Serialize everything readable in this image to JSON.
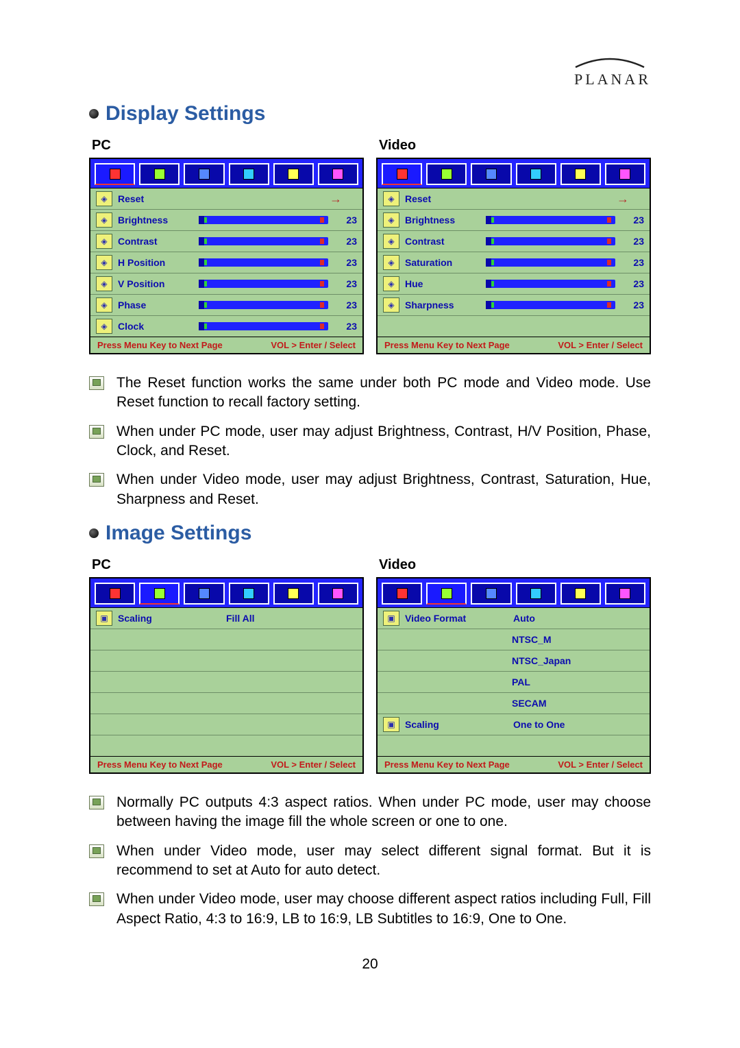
{
  "brand": "PLANAR",
  "page_number": "20",
  "sections": {
    "display": {
      "title": "Display Settings",
      "pc_label": "PC",
      "video_label": "Video",
      "footer_left": "Press Menu Key to Next Page",
      "footer_right": "VOL > Enter / Select",
      "pc_rows": [
        {
          "icon": "reset-icon",
          "label": "Reset",
          "arrow": "→"
        },
        {
          "icon": "brightness-icon",
          "label": "Brightness",
          "value": "23"
        },
        {
          "icon": "contrast-icon",
          "label": "Contrast",
          "value": "23"
        },
        {
          "icon": "hpos-icon",
          "label": "H  Position",
          "value": "23"
        },
        {
          "icon": "vpos-icon",
          "label": "V  Position",
          "value": "23"
        },
        {
          "icon": "phase-icon",
          "label": "Phase",
          "value": "23"
        },
        {
          "icon": "clock-icon",
          "label": "Clock",
          "value": "23"
        }
      ],
      "video_rows": [
        {
          "icon": "reset-icon",
          "label": "Reset",
          "arrow": "→"
        },
        {
          "icon": "brightness-icon",
          "label": "Brightness",
          "value": "23"
        },
        {
          "icon": "contrast-icon",
          "label": "Contrast",
          "value": "23"
        },
        {
          "icon": "saturation-icon",
          "label": "Saturation",
          "value": "23"
        },
        {
          "icon": "hue-icon",
          "label": "Hue",
          "value": "23"
        },
        {
          "icon": "sharpness-icon",
          "label": "Sharpness",
          "value": "23"
        }
      ],
      "notes": [
        "The Reset function works the same under both PC mode and Video mode. Use Reset function to recall factory setting.",
        "When under PC mode, user may adjust Brightness, Contrast, H/V Position, Phase, Clock, and Reset.",
        "When under Video mode, user may adjust Brightness, Contrast, Saturation, Hue, Sharpness and Reset."
      ]
    },
    "image": {
      "title": "Image Settings",
      "pc_label": "PC",
      "video_label": "Video",
      "footer_left": "Press Menu Key to Next Page",
      "footer_right": "VOL > Enter / Select",
      "pc_rows": [
        {
          "icon": "scaling-icon",
          "label": "Scaling",
          "option": "Fill  All"
        }
      ],
      "pc_blank_rows": 6,
      "video_rows": [
        {
          "icon": "videoformat-icon",
          "label": "Video  Format",
          "option": "Auto"
        },
        {
          "option": "NTSC_M"
        },
        {
          "option": "NTSC_Japan"
        },
        {
          "option": "PAL"
        },
        {
          "option": "SECAM"
        },
        {
          "icon": "scaling-icon",
          "label": "Scaling",
          "option": "One  to  One"
        }
      ],
      "video_blank_rows": 1,
      "notes": [
        "Normally PC outputs 4:3 aspect ratios. When under PC mode, user may choose between having the image fill the whole screen or one to one.",
        "When under Video mode, user may select different signal format. But it is recommend to set at Auto for auto detect.",
        "When under Video mode, user may choose different aspect ratios including Full, Fill Aspect Ratio, 4:3 to 16:9, LB to 16:9, LB Subtitles to 16:9, One to One."
      ]
    }
  },
  "tab_icons": [
    "display-tab-icon",
    "image-tab-icon",
    "audio-tab-icon",
    "setup-tab-icon",
    "osd-tab-icon",
    "info-tab-icon"
  ]
}
